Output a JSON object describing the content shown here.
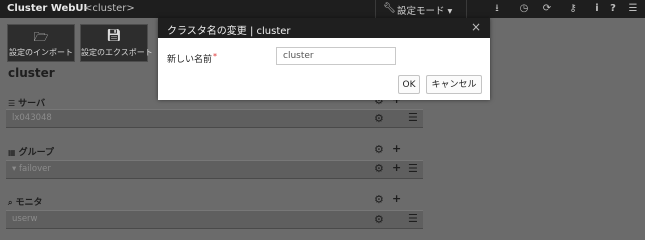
{
  "app": {
    "title": "Cluster WebUI",
    "cluster_label": "<cluster>"
  },
  "mode_menu": {
    "label": "設定モード ▾",
    "icon": "wrench-icon"
  },
  "top_icons": [
    "download-icon",
    "clock-icon",
    "refresh-icon",
    "key-icon",
    "info-icon",
    "help-icon",
    "menu-icon"
  ],
  "toolbar": {
    "import_label": "設定のインポート",
    "export_label": "設定のエクスポート"
  },
  "main": {
    "cluster_name": "cluster",
    "sections": {
      "servers": {
        "title": "サーバ",
        "rows": [
          "lx043048"
        ]
      },
      "groups": {
        "title": "グループ",
        "rows": [
          "▾ failover"
        ]
      },
      "monitors": {
        "title": "モニタ",
        "rows": [
          "userw"
        ]
      }
    }
  },
  "dialog": {
    "title": "クラスタ名の変更 | cluster",
    "close": "×",
    "field_label": "新しい名前",
    "required_mark": "*",
    "input_value": "cluster",
    "ok_label": "OK",
    "cancel_label": "キャンセル"
  }
}
